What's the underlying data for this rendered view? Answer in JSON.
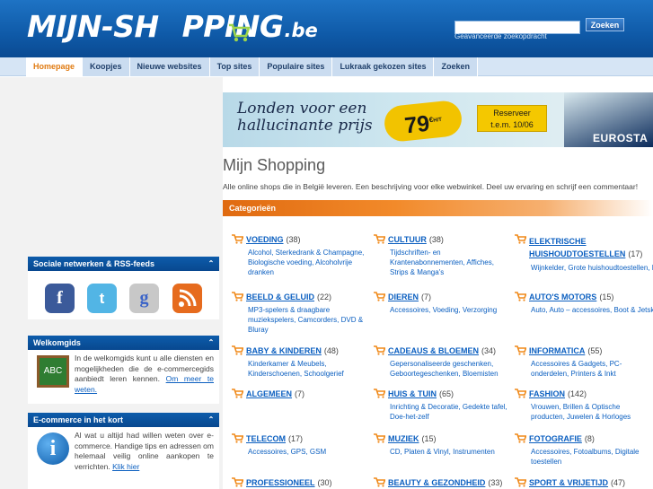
{
  "header": {
    "logo_main": "MIJN-SH",
    "logo_rest": "PPING",
    "logo_tld": ".be",
    "search_placeholder": "",
    "search_button": "Zoeken",
    "advanced_search": "Geavanceerde zoekopdracht"
  },
  "nav": {
    "tabs": [
      "Homepage",
      "Koopjes",
      "Nieuwe websites",
      "Top sites",
      "Populaire sites",
      "Lukraak gekozen sites",
      "Zoeken"
    ],
    "active": "Homepage"
  },
  "banner": {
    "text": "Londen voor een hallucinante prijs",
    "price": "79",
    "price_unit": "€",
    "price_note": "H/T",
    "reserveer_line1": "Reserveer",
    "reserveer_line2": "t.e.m. 10/06",
    "brand": "EUROSTA"
  },
  "main": {
    "title": "Mijn Shopping",
    "intro": "Alle online shops die in België leveren. Een beschrijving voor elke webwinkel. Deel uw ervaring en schrijf een commentaar!",
    "categories_header": "Categorieën"
  },
  "sidebar": {
    "social_title": "Sociale netwerken & RSS-feeds",
    "social_icons": [
      "facebook-icon",
      "twitter-icon",
      "google-icon",
      "rss-icon"
    ],
    "welcome_title": "Welkomgids",
    "welcome_text": "In de welkomgids kunt u alle diensten en mogelijkheden die de e-commercegids aanbiedt leren kennen.",
    "welcome_link": "Om meer te weten.",
    "welcome_img_text": "ABC",
    "ecommerce_title": "E-commerce in het kort",
    "ecommerce_text": "Al wat u altijd had willen weten over e-commerce. Handige tips en adressen om helemaal veilig online aankopen te verrichten.",
    "ecommerce_link": "Klik hier",
    "ecommerce_img_text": "i"
  },
  "categories": [
    {
      "name": "VOEDING",
      "count": "(38)",
      "sub": "Alcohol, Sterkedrank & Champagne, Biologische voeding, Alcoholvrije dranken"
    },
    {
      "name": "CULTUUR",
      "count": "(38)",
      "sub": "Tijdschriften- en Krantenabonnementen, Affiches, Strips & Manga's"
    },
    {
      "name": "ELEKTRISCHE HUISHOUDTOESTELLEN",
      "count": "(17)",
      "sub": "Wijnkelder, Grote huishoudtoestellen, Kleine huishoudtoestellen - huishouden"
    },
    {
      "name": "BEELD & GELUID",
      "count": "(22)",
      "sub": "MP3-spelers & draagbare muziekspelers, Camcorders, DVD & Bluray"
    },
    {
      "name": "DIEREN",
      "count": "(7)",
      "sub": "Accessoires, Voeding, Verzorging"
    },
    {
      "name": "AUTO'S MOTORS",
      "count": "(15)",
      "sub": "Auto, Auto – accessoires, Boot & Jetski"
    },
    {
      "name": "BABY & KINDEREN",
      "count": "(48)",
      "sub": "Kinderkamer & Meubels, Kinderschoenen, Schoolgerief"
    },
    {
      "name": "CADEAUS & BLOEMEN",
      "count": "(34)",
      "sub": "Gepersonaliseerde geschenken, Geboortegeschenken, Bloemisten"
    },
    {
      "name": "INFORMATICA",
      "count": "(55)",
      "sub": "Accessoires & Gadgets, PC-onderdelen, Printers & Inkt"
    },
    {
      "name": "ALGEMEEN",
      "count": "(7)",
      "sub": ""
    },
    {
      "name": "HUIS & TUIN",
      "count": "(65)",
      "sub": "Inrichting & Decoratie, Gedekte tafel, Doe-het-zelf"
    },
    {
      "name": "FASHION",
      "count": "(142)",
      "sub": "Vrouwen, Brillen & Optische producten, Juwelen & Horloges"
    },
    {
      "name": "TELECOM",
      "count": "(17)",
      "sub": "Accessoires, GPS, GSM"
    },
    {
      "name": "MUZIEK",
      "count": "(15)",
      "sub": "CD, Platen & Vinyl, Instrumenten"
    },
    {
      "name": "FOTOGRAFIE",
      "count": "(8)",
      "sub": "Accessoires, Fotoalbums, Digitale toestellen"
    },
    {
      "name": "PROFESSIONEEL",
      "count": "(30)",
      "sub": ""
    },
    {
      "name": "BEAUTY & GEZONDHEID",
      "count": "(33)",
      "sub": ""
    },
    {
      "name": "SPORT & VRIJETIJD",
      "count": "(47)",
      "sub": ""
    }
  ],
  "colors": {
    "header_blue": "#0f5aa8",
    "link_blue": "#0b5fc0",
    "accent_orange": "#e07a10"
  }
}
